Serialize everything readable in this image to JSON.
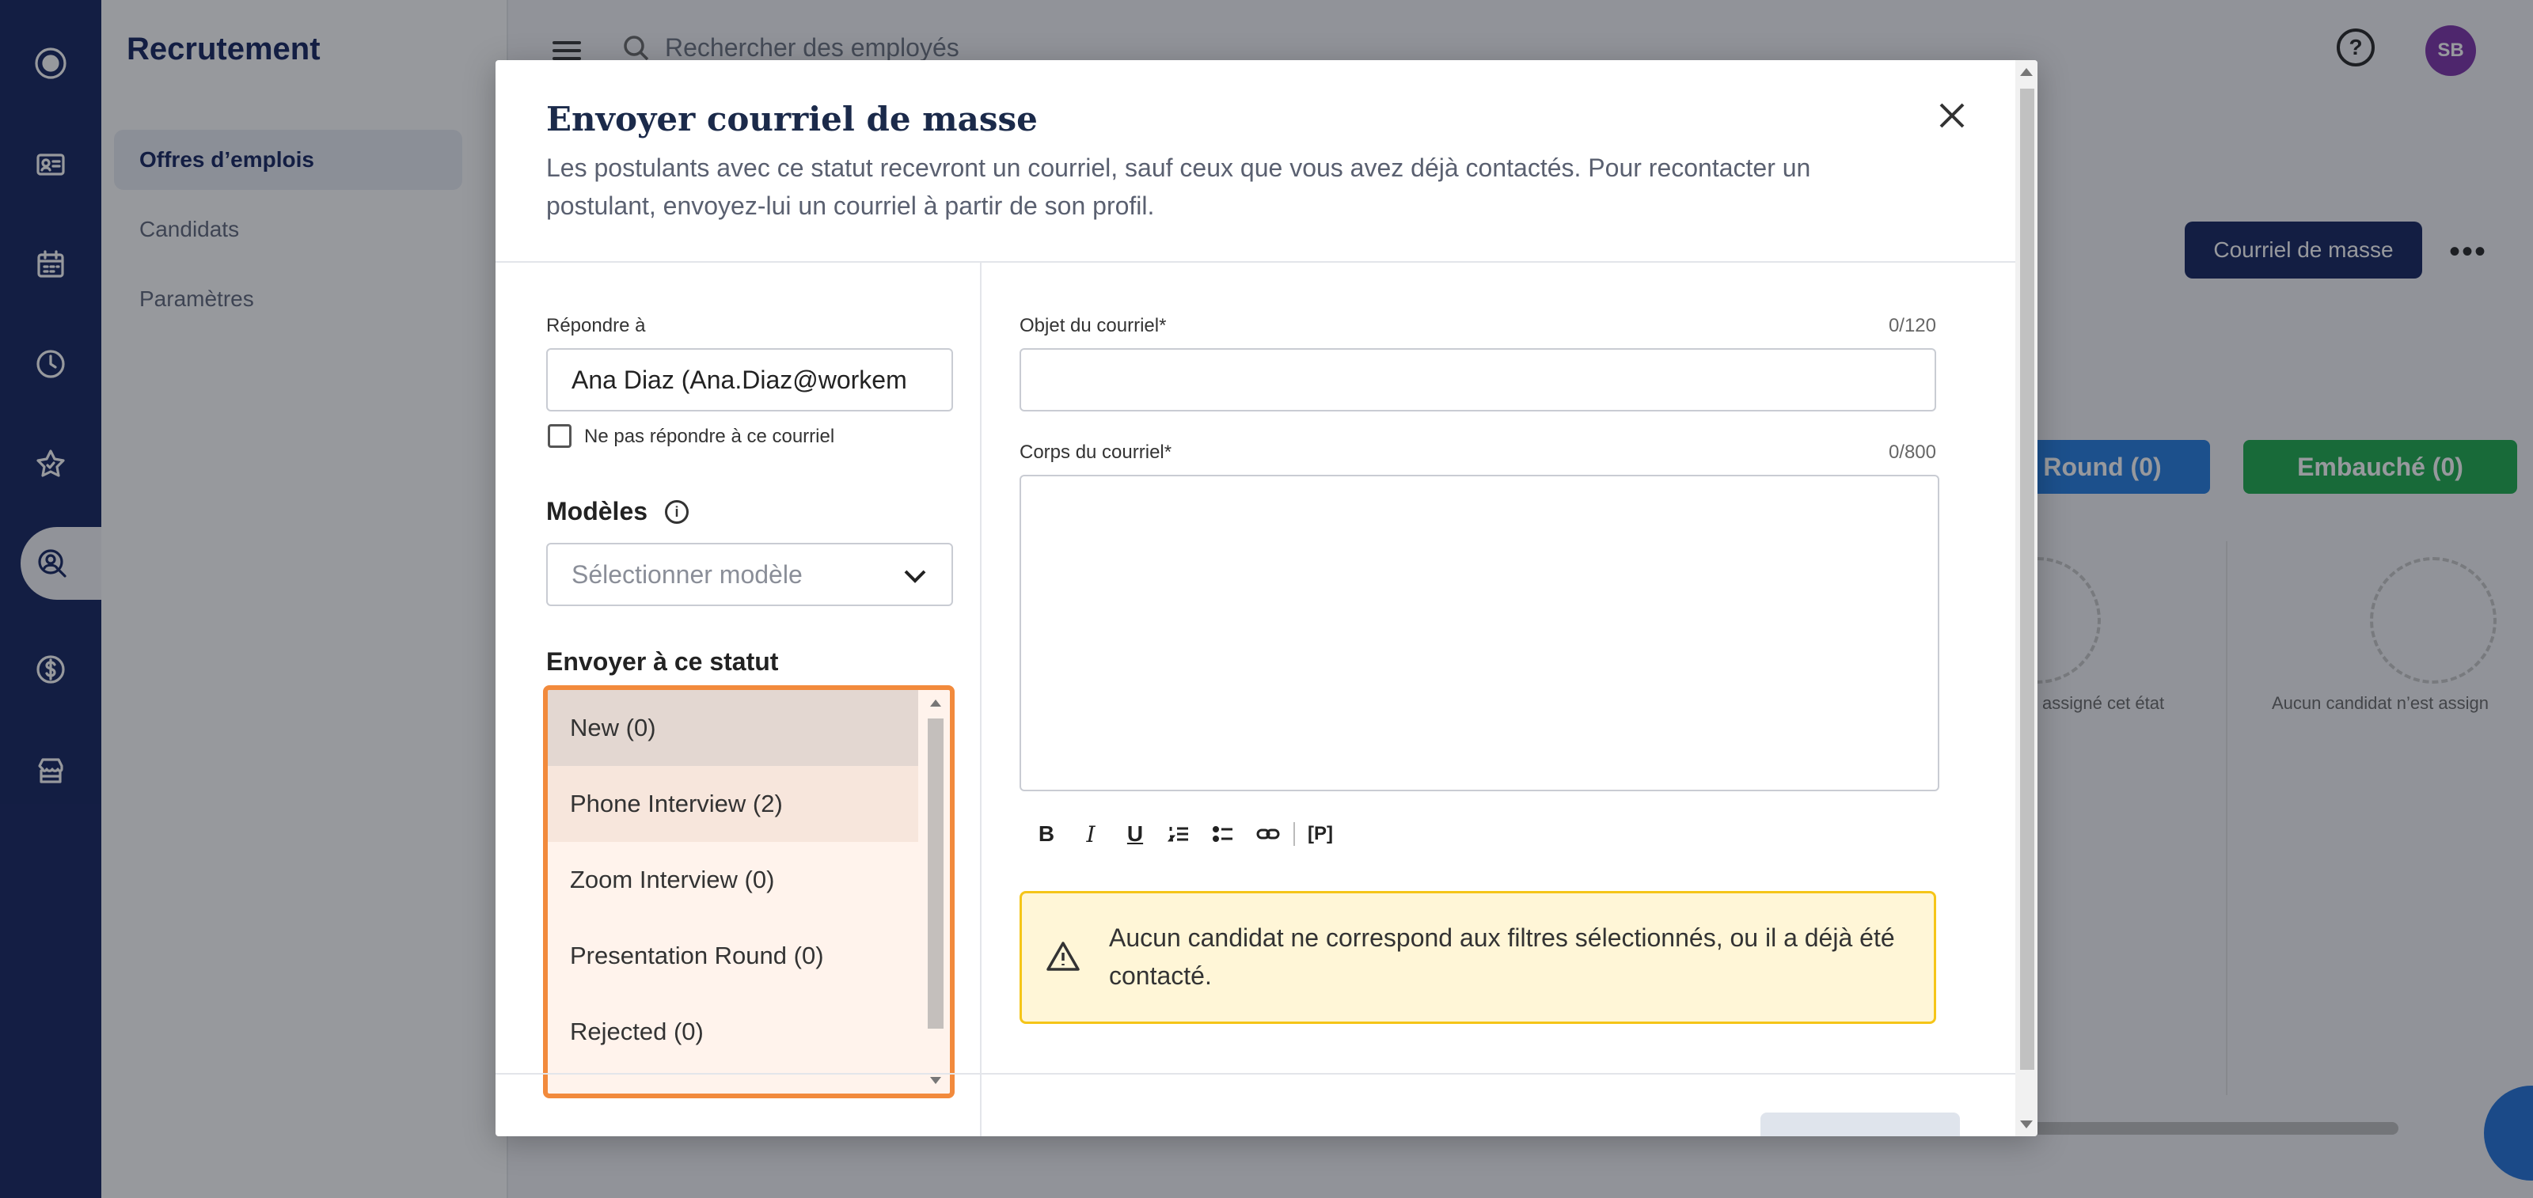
{
  "app": {
    "section_title": "Recrutement",
    "nav": [
      "Offres d’emplois",
      "Candidats",
      "Paramètres"
    ],
    "search_placeholder": "Rechercher des employés",
    "avatar_initials": "SB",
    "mass_email_button": "Courriel de masse",
    "more_menu": "•••",
    "columns": [
      {
        "label": "Round (0)",
        "color": "#1f7ae0",
        "empty_text": "assigné cet état"
      },
      {
        "label": "Embauché (0)",
        "color": "#18a94a",
        "empty_text": "Aucun candidat n’est assign"
      }
    ]
  },
  "modal": {
    "title": "Envoyer courriel de masse",
    "description": "Les postulants avec ce statut recevront un courriel, sauf ceux que vous avez déjà contactés. Pour recontacter un postulant, envoyez-lui un courriel à partir de son profil.",
    "reply_to": {
      "label": "Répondre à",
      "value": "Ana Diaz (Ana.Diaz@workem",
      "no_reply_label": "Ne pas répondre à ce courriel",
      "no_reply_checked": false
    },
    "templates": {
      "label": "Modèles",
      "placeholder": "Sélectionner modèle"
    },
    "status": {
      "label": "Envoyer à ce statut",
      "options": [
        "New (0)",
        "Phone Interview (2)",
        "Zoom Interview (0)",
        "Presentation Round (0)",
        "Rejected (0)"
      ],
      "selected_index": 0,
      "hover_index": 1,
      "highlight_color": "#f28a3c"
    },
    "subject": {
      "label": "Objet du courriel*",
      "counter": "0/120",
      "value": ""
    },
    "body": {
      "label": "Corps du courriel*",
      "counter": "0/800",
      "value": ""
    },
    "toolbar": [
      "bold-icon",
      "italic-icon",
      "underline-icon",
      "ordered-list-icon",
      "bullet-list-icon",
      "link-icon",
      "placeholder-icon"
    ],
    "toolbar_glyphs": {
      "bold": "B",
      "italic": "I",
      "underline": "U",
      "placeholder": "[P]"
    },
    "warning": {
      "text": "Aucun candidat ne correspond aux filtres sélectionnés, ou il a déjà été contacté.",
      "color": "#f5c518"
    }
  }
}
